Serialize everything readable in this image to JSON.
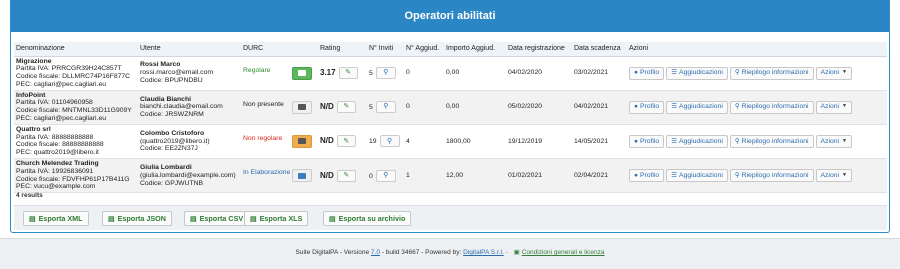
{
  "header": {
    "title": "Operatori abilitati"
  },
  "columns": [
    "Denominazione",
    "Utente",
    "DURC",
    "Rating",
    "N° Inviti",
    "N° Aggiud.",
    "Importo Aggiud.",
    "Data registrazione",
    "Data scadenza",
    "Azioni"
  ],
  "rows": [
    {
      "name": "Migrazione",
      "piva": "Partita IVA: PRRCGR39H24C857T",
      "cf": "Codice fiscale: DLLMRC74P16F877C",
      "pec": "PEC: cagliari@pec.cagliari.eu",
      "user_name": "Rossi Marco",
      "user_email": "rossi.marco@email.com",
      "user_code": "Codice: BPUPNDBU",
      "durc": "Regolare",
      "rating": "3.17",
      "inviti": "5",
      "aggiud": "0",
      "importo": "0,00",
      "data_reg": "04/02/2020",
      "data_scad": "03/02/2021"
    },
    {
      "name": "InfoPoint",
      "piva": "Partita IVA: 01104960958",
      "cf": "Codice fiscale: MNTMNL33D11G909Y",
      "pec": "PEC: cagliari@pec.cagliari.eu",
      "user_name": "Claudia Bianchi",
      "user_email": "bianchi.claudia@email.com",
      "user_code": "Codice: JRSWZNRM",
      "durc": "Non presente",
      "rating": "N/D",
      "inviti": "5",
      "aggiud": "0",
      "importo": "0,00",
      "data_reg": "05/02/2020",
      "data_scad": "04/02/2021"
    },
    {
      "name": "Quattro srl",
      "piva": "Partita IVA: 88888888888",
      "cf": "Codice fiscale: 88888888888",
      "pec": "PEC: quattro2019@libero.it",
      "user_name": "Colombo Cristoforo",
      "user_email": "(quattro2019@libero.it)",
      "user_code": "Codice: EE2ZN37J",
      "durc": "Non regolare",
      "rating": "N/D",
      "inviti": "19",
      "aggiud": "4",
      "importo": "1800,00",
      "data_reg": "19/12/2019",
      "data_scad": "14/05/2021"
    },
    {
      "name": "Church Melendez Trading",
      "piva": "Partita IVA: 19926836091",
      "cf": "Codice fiscale: FDVFHP61P17B411G",
      "pec": "PEC: vucu@example.com",
      "user_name": "Giulia Lombardi",
      "user_email": "(giulia.lombardi@example.com)",
      "user_code": "Codice: GPJWUTNB",
      "durc": "In Elaborazione",
      "rating": "N/D",
      "inviti": "0",
      "aggiud": "1",
      "importo": "12,00",
      "data_reg": "01/02/2021",
      "data_scad": "02/04/2021"
    }
  ],
  "actions": {
    "profilo": "Profilo",
    "aggiudicazioni": "Aggiudicazioni",
    "riepilogo": "Riepilogo informazioni",
    "azioni": "Azioni"
  },
  "results": "4 results",
  "export": {
    "xml": "Esporta XML",
    "json": "Esporta JSON",
    "csv": "Esporta CSV",
    "xls": "Esporta XLS",
    "archivio": "Esporta su archivio"
  },
  "footer": {
    "prefix": "Suite DigitalPA - Versione",
    "version": "7.0",
    "build": "- build 34667 - Powered by:",
    "company": "DigitalPA S.r.l.",
    "dash": "-",
    "conditions": "Condizioni generali e licenza"
  },
  "colors": {
    "header_bg": "#2b86c5",
    "regolare": "#2e8b2e",
    "non_regolare": "#d9261c",
    "in_elaborazione": "#2b6cb0"
  }
}
